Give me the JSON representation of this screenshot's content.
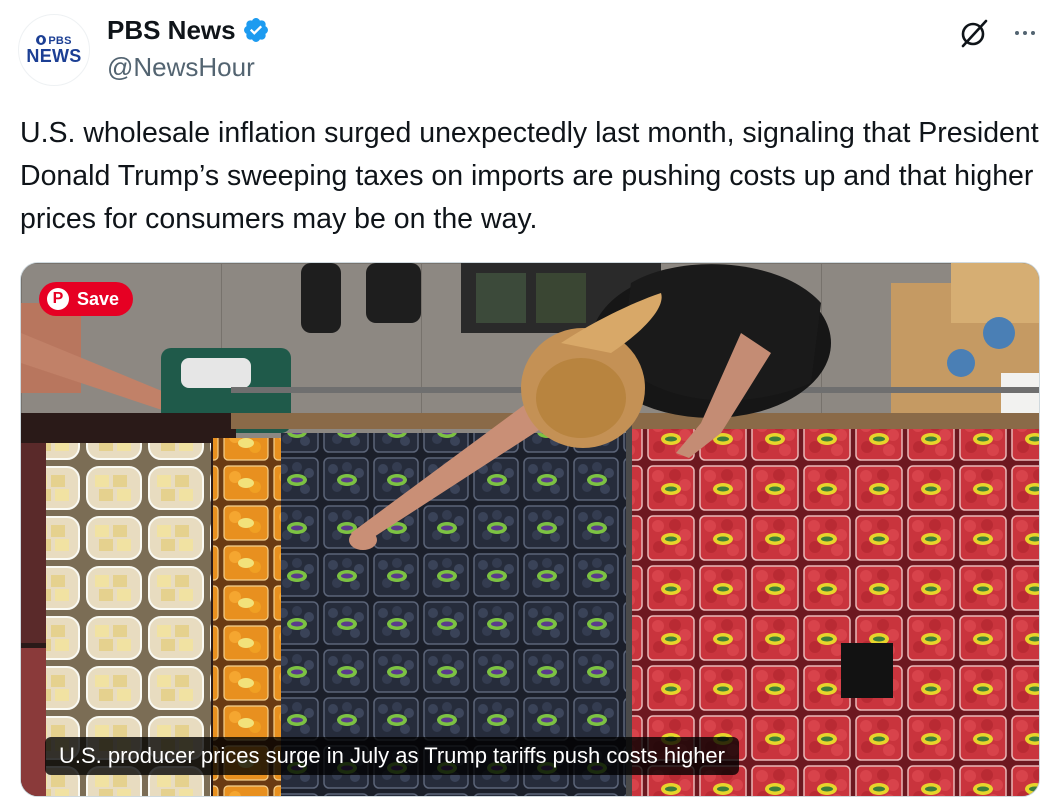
{
  "account": {
    "display_name": "PBS News",
    "handle": "@NewsHour",
    "avatar_line1": "PBS",
    "avatar_line2": "NEWS",
    "verified": true,
    "verified_color": "#1d9bf0"
  },
  "actions": {
    "grok_icon": "grok-icon",
    "more_icon": "more-horizontal-icon"
  },
  "tweet": {
    "text": "U.S. wholesale inflation surged unexpectedly last month, signaling that President Donald Trump’s sweeping taxes on imports are pushing costs up and that higher prices for consumers may be on the way."
  },
  "media": {
    "save_label": "Save",
    "save_color": "#e60023",
    "caption": "U.S. producer prices surge in July as Trump tariffs push costs higher"
  }
}
